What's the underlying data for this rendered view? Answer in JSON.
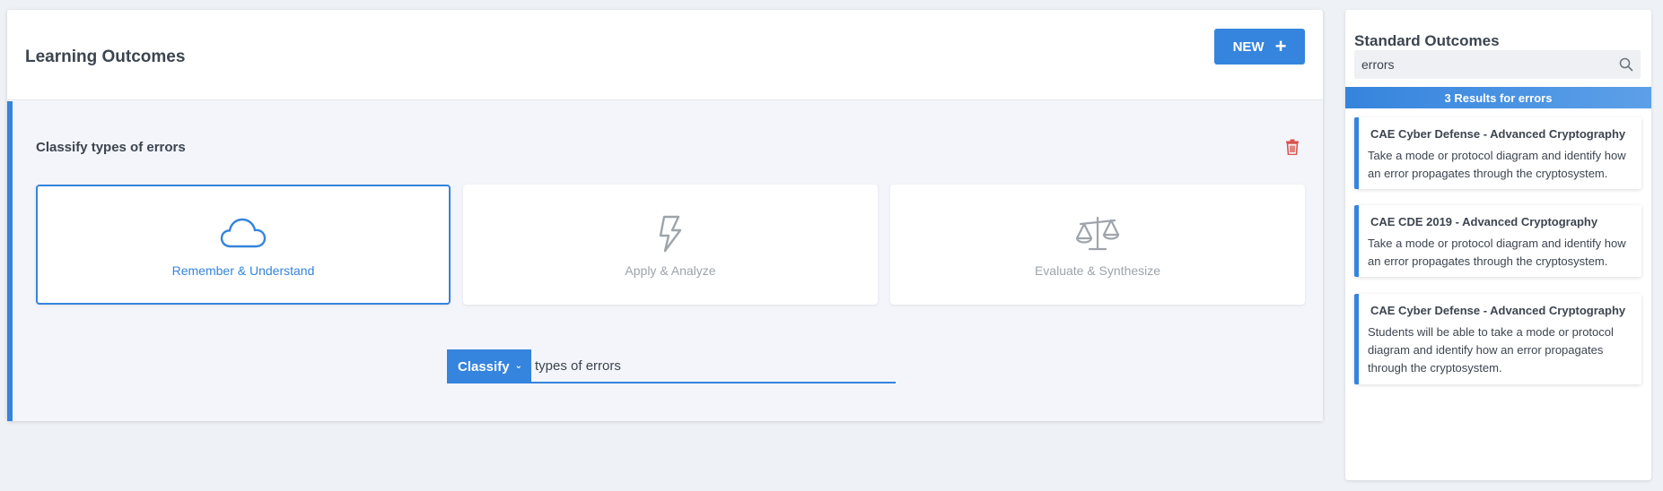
{
  "header": {
    "title": "Learning Outcomes",
    "new_label": "NEW",
    "new_icon": "plus-icon"
  },
  "outcome": {
    "title": "Classify types of errors",
    "levels": [
      {
        "label": "Remember & Understand",
        "icon": "cloud-icon",
        "selected": true
      },
      {
        "label": "Apply & Analyze",
        "icon": "lightning-icon",
        "selected": false
      },
      {
        "label": "Evaluate & Synthesize",
        "icon": "scales-icon",
        "selected": false
      }
    ],
    "verb": "Classify",
    "text": "types of errors"
  },
  "sidebar": {
    "title": "Standard Outcomes",
    "search_value": "errors",
    "results_label": "3 Results for errors",
    "results": [
      {
        "title": "CAE Cyber Defense - Advanced Cryptography",
        "description": "Take a mode or protocol diagram and identify how an error propagates through the cryptosystem."
      },
      {
        "title": "CAE CDE 2019 - Advanced Cryptography",
        "description": "Take a mode or protocol diagram and identify how an error propagates through the cryptosystem."
      },
      {
        "title": "CAE Cyber Defense - Advanced Cryptography",
        "description": "Students will be able to take a mode or protocol diagram and identify how an error propagates through the cryptosystem."
      }
    ]
  },
  "colors": {
    "accent": "#3584dd",
    "delete": "#d9534f",
    "muted": "#9ea4ab"
  }
}
